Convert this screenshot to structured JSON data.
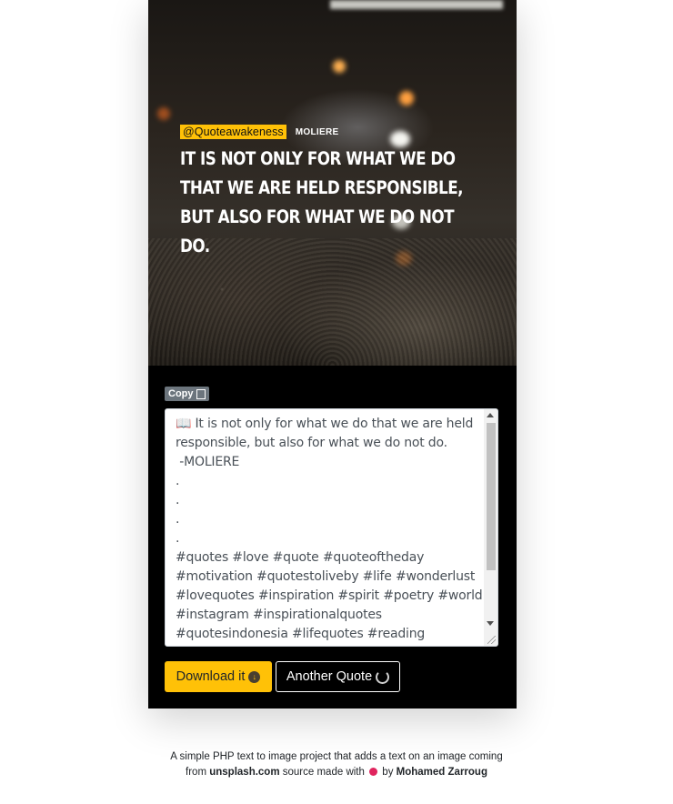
{
  "image": {
    "handle": "@Quoteawakeness",
    "author": "MOLIERE",
    "quote": "It is not only for what we do that we are held responsible, but also for what we do not do."
  },
  "copy_button": {
    "label": "Copy",
    "icon": "copy-icon"
  },
  "textarea": {
    "value": "📖 It is not only for what we do that we are held responsible, but also for what we do not do.\n -MOLIERE\n.\n.\n.\n.\n#quotes #love #quote #quoteoftheday #motivation #quotestoliveby #life #wonderlust #lovequotes #inspiration #spirit #poetry #world #instagram #inspirationalquotes #quotesindonesia #lifequotes #reading #quotesaboutlife #alone"
  },
  "buttons": {
    "download": {
      "label": "Download it",
      "icon": "download-icon"
    },
    "another": {
      "label": "Another Quote",
      "icon": "refresh-icon"
    }
  },
  "footer": {
    "line1": "A simple PHP text to image project that adds a text on an image coming",
    "from": "from",
    "source": "unsplash.com",
    "made_with": "source made with",
    "by": "by",
    "author": "Mohamed Zarroug"
  },
  "colors": {
    "accent": "#ffc107",
    "card": "#000000",
    "heart": "#e0245e"
  }
}
